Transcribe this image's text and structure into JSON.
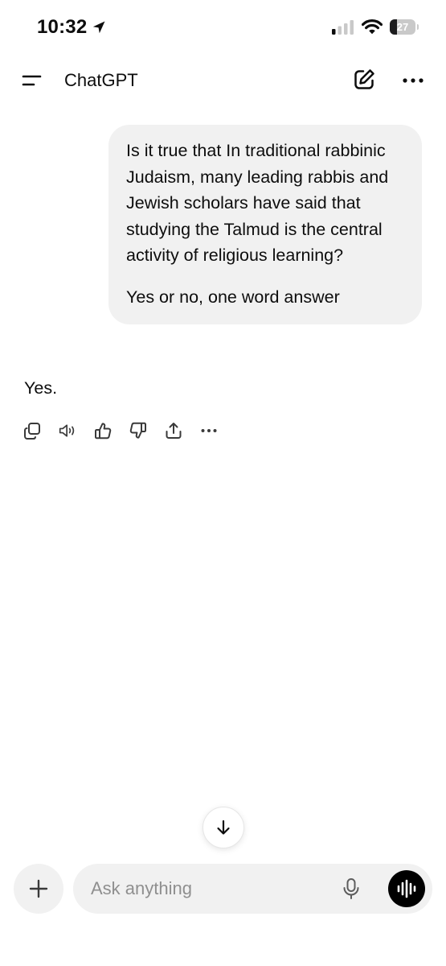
{
  "status_bar": {
    "time": "10:32",
    "battery_percent": "27",
    "battery_level": 0.27,
    "signal_bars": 1,
    "icons": [
      "location-arrow-icon",
      "cellular-signal-icon",
      "wifi-icon",
      "battery-icon"
    ]
  },
  "header": {
    "title": "ChatGPT",
    "icons": [
      "menu-icon",
      "new-chat-icon",
      "more-icon"
    ]
  },
  "conversation": {
    "user_message": {
      "paragraphs": [
        "Is it true that In traditional rabbinic Judaism, many leading rabbis and Jewish scholars have said that studying the Talmud is the central activity of religious learning?",
        "Yes or no, one word answer"
      ]
    },
    "assistant_message": {
      "text": "Yes.",
      "actions": [
        "copy-icon",
        "read-aloud-icon",
        "thumbs-up-icon",
        "thumbs-down-icon",
        "share-icon",
        "more-icon"
      ]
    }
  },
  "composer": {
    "placeholder": "Ask anything",
    "value": "",
    "icons": [
      "plus-icon",
      "microphone-icon",
      "voice-mode-icon",
      "arrow-down-icon"
    ]
  },
  "colors": {
    "background": "#ffffff",
    "bubble": "#f1f1f1",
    "text": "#0d0d0d",
    "placeholder": "#8f8f8f",
    "voice_button": "#000000"
  }
}
